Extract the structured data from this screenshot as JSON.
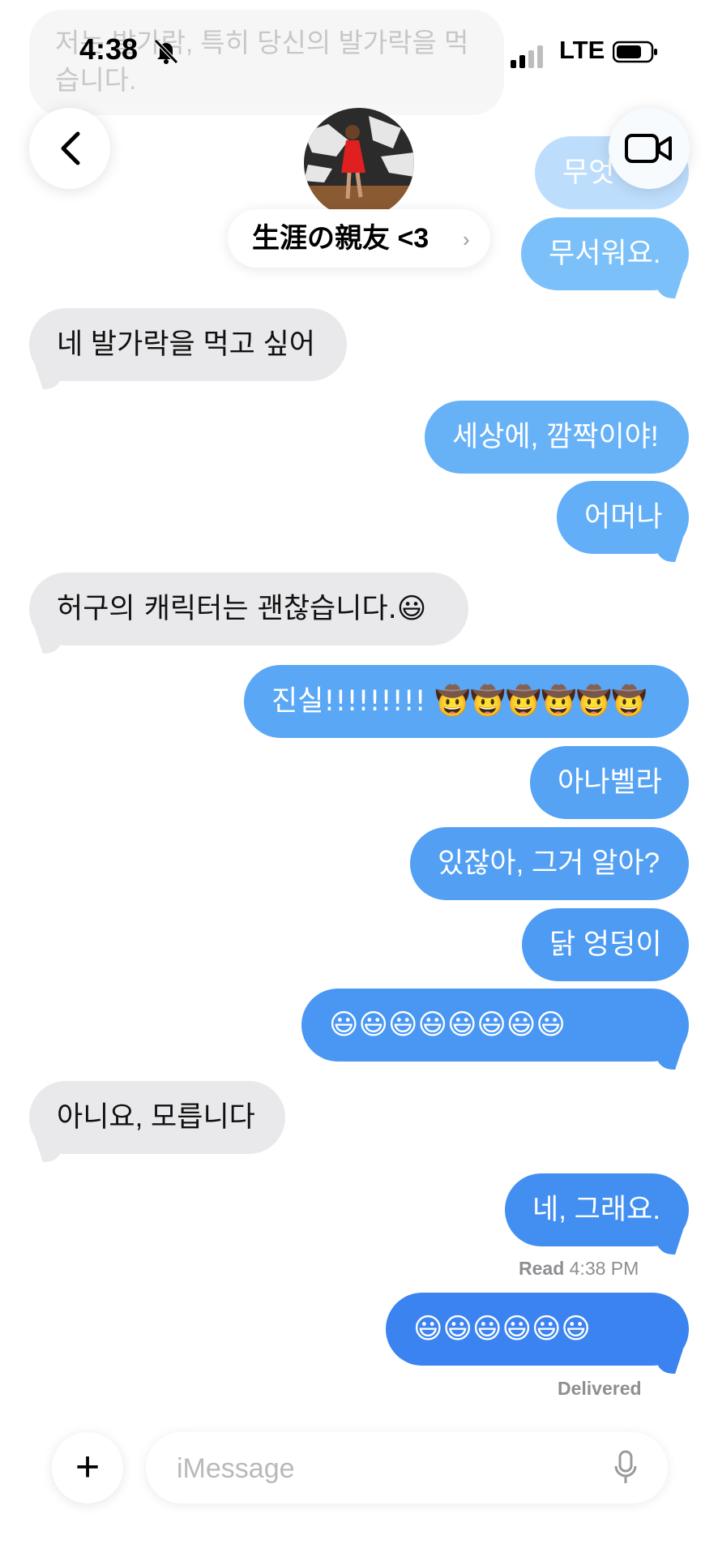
{
  "status_bar": {
    "time": "4:38",
    "network": "LTE"
  },
  "header": {
    "contact_name": "生涯の親友 <3",
    "chevron": "›",
    "back_icon": "chevron-left-icon",
    "video_icon": "video-camera-icon"
  },
  "ghost": {
    "top_incoming": "저는 발가락, 특히 당신의 발가락을 먹습니다.",
    "out1": "무엇",
    "out2": "무서워요."
  },
  "messages": [
    {
      "dir": "in",
      "text": "네 발가락을 먹고 싶어"
    },
    {
      "dir": "out",
      "text": "세상에, 깜짝이야!"
    },
    {
      "dir": "out",
      "text": "어머나"
    },
    {
      "dir": "in",
      "text": "허구의 캐릭터는 괜찮습니다.😃"
    },
    {
      "dir": "out",
      "text": "진실!!!!!!!!! 🤠🤠🤠🤠🤠🤠"
    },
    {
      "dir": "out",
      "text": "아나벨라"
    },
    {
      "dir": "out",
      "text": "있잖아, 그거 알아?"
    },
    {
      "dir": "out",
      "text": "닭 엉덩이"
    },
    {
      "dir": "out",
      "text": "😃😃😃😃😃😃😃😃"
    },
    {
      "dir": "in",
      "text": "아니요, 모릅니다"
    },
    {
      "dir": "out",
      "text": "네, 그래요."
    },
    {
      "dir": "out",
      "text": "😃😃😃😃😃😃"
    }
  ],
  "receipts": {
    "read_label": "Read",
    "read_time": "4:38 PM",
    "delivered": "Delivered"
  },
  "composer": {
    "placeholder": "iMessage",
    "add_icon": "plus-icon",
    "mic_icon": "microphone-icon",
    "plus_glyph": "+"
  },
  "colors": {
    "incoming": "#e9e9eb",
    "outgoing_light": "#64b1f7",
    "outgoing_dark": "#3b83f0"
  }
}
